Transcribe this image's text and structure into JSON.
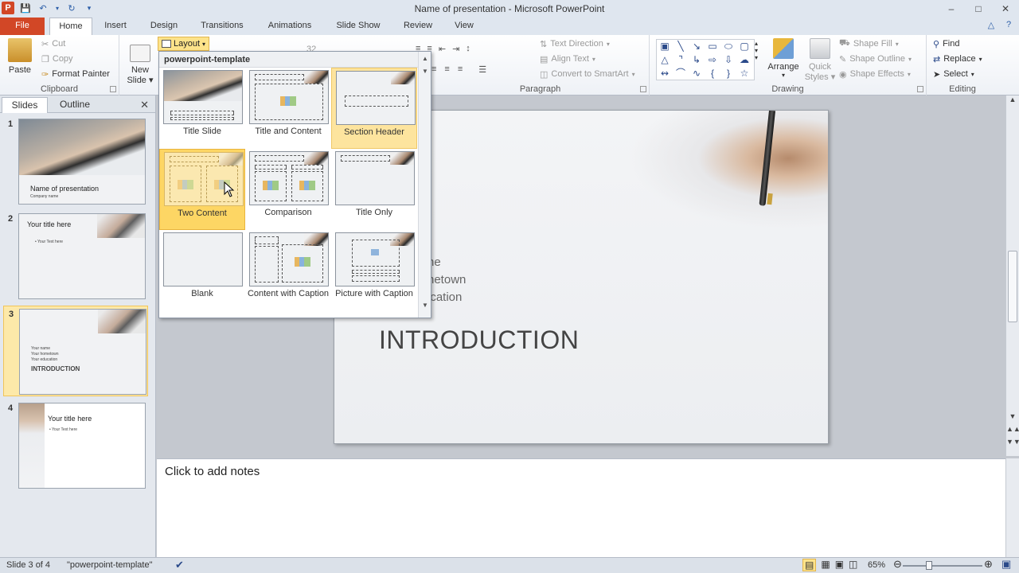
{
  "window": {
    "title": "Name of presentation - Microsoft PowerPoint",
    "controls": [
      "–",
      "□",
      "✕"
    ]
  },
  "tabs": [
    "File",
    "Home",
    "Insert",
    "Design",
    "Transitions",
    "Animations",
    "Slide Show",
    "Review",
    "View"
  ],
  "ribbon": {
    "clipboard": {
      "paste": "Paste",
      "cut": "Cut",
      "copy": "Copy",
      "format_painter": "Format Painter",
      "label": "Clipboard"
    },
    "slides": {
      "new_slide": "New Slide",
      "new_slide_line1": "New",
      "new_slide_line2": "Slide ▾",
      "layout": "Layout"
    },
    "font": {
      "size": "32"
    },
    "paragraph": {
      "text_direction": "Text Direction",
      "align_text": "Align Text",
      "convert_smartart": "Convert to SmartArt",
      "label": "Paragraph"
    },
    "drawing": {
      "arrange": "Arrange",
      "quick_styles_1": "Quick",
      "quick_styles_2": "Styles ▾",
      "shape_fill": "Shape Fill",
      "shape_outline": "Shape Outline",
      "shape_effects": "Shape Effects",
      "label": "Drawing"
    },
    "editing": {
      "find": "Find",
      "replace": "Replace",
      "select": "Select",
      "label": "Editing"
    }
  },
  "slide_pane": {
    "tabs": [
      "Slides",
      "Outline"
    ],
    "close": "✕",
    "thumbs": [
      {
        "num": "1",
        "title": "Name of presentation",
        "sub": "Company name"
      },
      {
        "num": "2",
        "title": "Your title here",
        "sub": "• Your Text here"
      },
      {
        "num": "3",
        "lines": [
          "Your name",
          "Your hometown",
          "Your education"
        ],
        "title": "INTRODUCTION"
      },
      {
        "num": "4",
        "title": "Your title here",
        "sub": "• Your Text here"
      }
    ]
  },
  "gallery": {
    "header": "powerpoint-template",
    "layouts": [
      "Title Slide",
      "Title and Content",
      "Section Header",
      "Two Content",
      "Comparison",
      "Title Only",
      "Blank",
      "Content with Caption",
      "Picture with Caption"
    ]
  },
  "slide": {
    "lines": [
      "ne",
      "netown",
      "ication"
    ],
    "heading": "INTRODUCTION"
  },
  "notes": {
    "placeholder": "Click to add notes"
  },
  "status": {
    "slide_info": "Slide 3 of 4",
    "theme": "\"powerpoint-template\"",
    "zoom": "65%"
  }
}
